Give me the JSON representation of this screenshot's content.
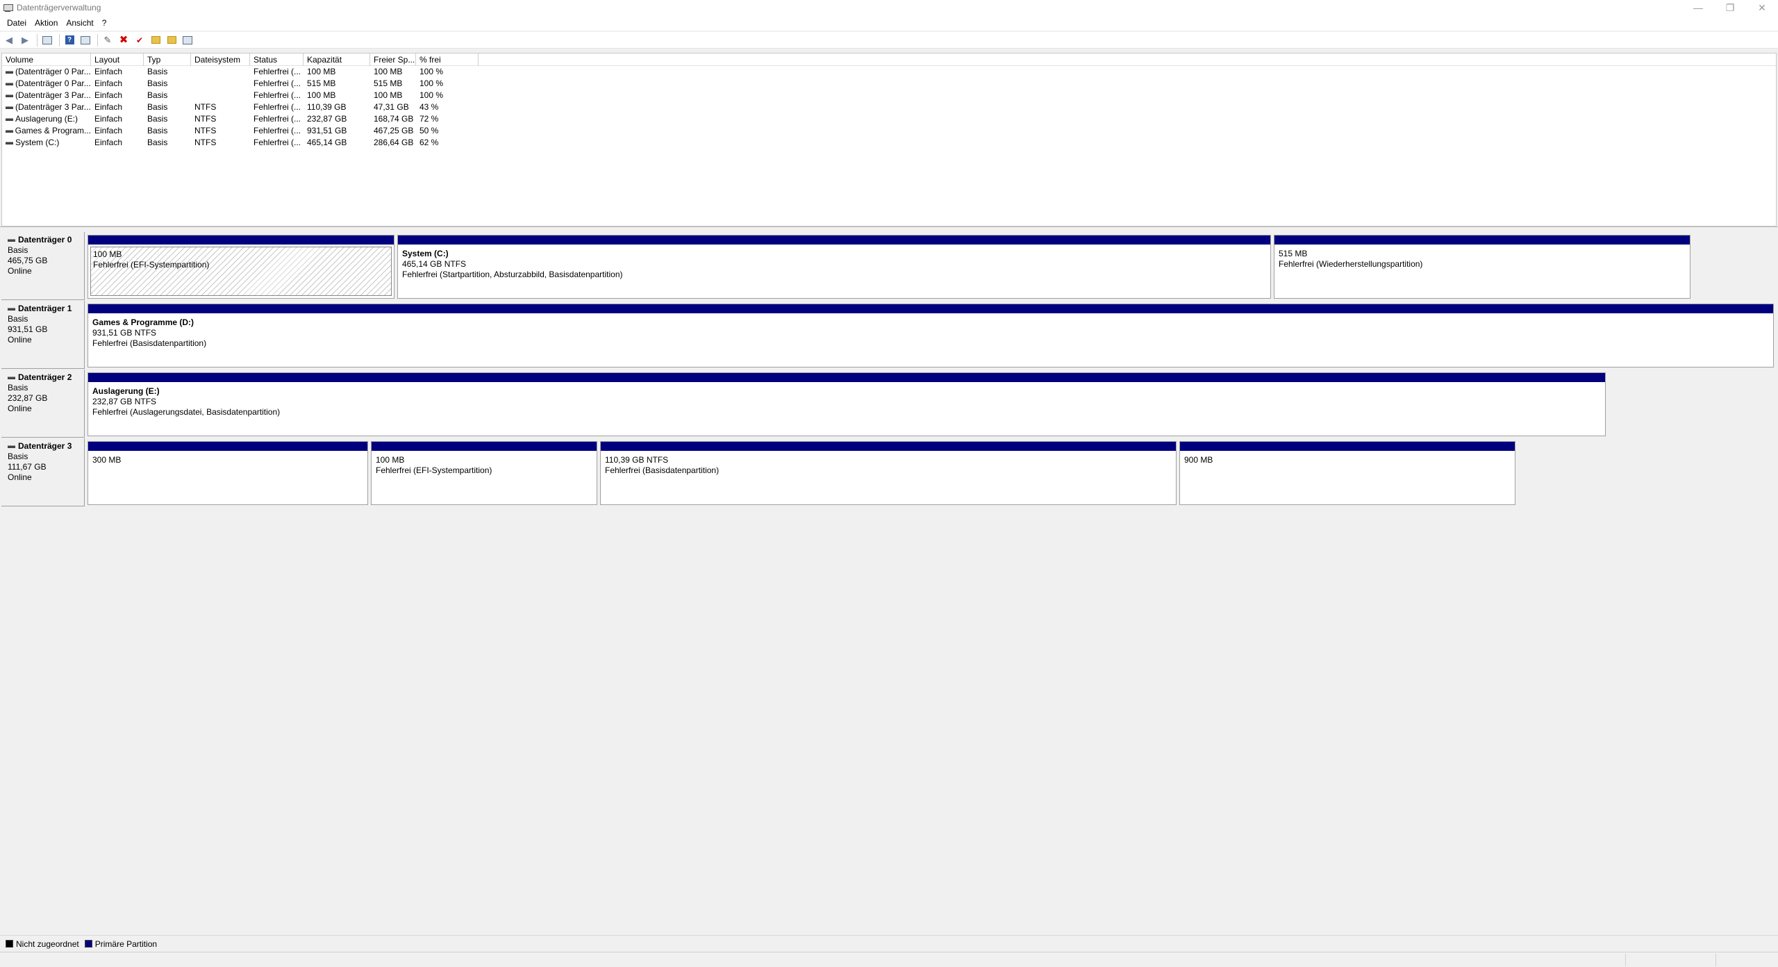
{
  "window": {
    "title": "Datenträgerverwaltung",
    "controls": {
      "minimize": "—",
      "restore": "❐",
      "close": "✕"
    }
  },
  "menu": [
    "Datei",
    "Aktion",
    "Ansicht",
    "?"
  ],
  "toolbar": {
    "icons": [
      "back-arrow-icon",
      "forward-arrow-icon",
      "console-tree-icon",
      "help-icon",
      "properties-icon",
      "connect-icon",
      "delete-icon",
      "checkmark-icon",
      "folder-up-icon",
      "folder-new-icon",
      "view-icon"
    ]
  },
  "volume_list": {
    "columns": [
      "Volume",
      "Layout",
      "Typ",
      "Dateisystem",
      "Status",
      "Kapazität",
      "Freier Sp...",
      "% frei"
    ],
    "rows": [
      [
        "(Datenträger 0 Par...",
        "Einfach",
        "Basis",
        "",
        "Fehlerfrei (...",
        "100 MB",
        "100 MB",
        "100 %"
      ],
      [
        "(Datenträger 0 Par...",
        "Einfach",
        "Basis",
        "",
        "Fehlerfrei (...",
        "515 MB",
        "515 MB",
        "100 %"
      ],
      [
        "(Datenträger 3 Par...",
        "Einfach",
        "Basis",
        "",
        "Fehlerfrei (...",
        "100 MB",
        "100 MB",
        "100 %"
      ],
      [
        "(Datenträger 3 Par...",
        "Einfach",
        "Basis",
        "NTFS",
        "Fehlerfrei (...",
        "110,39 GB",
        "47,31 GB",
        "43 %"
      ],
      [
        "Auslagerung (E:)",
        "Einfach",
        "Basis",
        "NTFS",
        "Fehlerfrei (...",
        "232,87 GB",
        "168,74 GB",
        "72 %"
      ],
      [
        "Games & Program...",
        "Einfach",
        "Basis",
        "NTFS",
        "Fehlerfrei (...",
        "931,51 GB",
        "467,25 GB",
        "50 %"
      ],
      [
        "System (C:)",
        "Einfach",
        "Basis",
        "NTFS",
        "Fehlerfrei (...",
        "465,14 GB",
        "286,64 GB",
        "62 %"
      ]
    ]
  },
  "disks": [
    {
      "name": "Datenträger 0",
      "type": "Basis",
      "size": "465,75 GB",
      "state": "Online",
      "partitions": [
        {
          "title": "",
          "size": "100 MB",
          "status": "Fehlerfrei (EFI-Systempartition)"
        },
        {
          "title": "System  (C:)",
          "size": "465,14 GB NTFS",
          "status": "Fehlerfrei (Startpartition, Absturzabbild, Basisdatenpartition)"
        },
        {
          "title": "",
          "size": "515 MB",
          "status": "Fehlerfrei (Wiederherstellungspartition)"
        }
      ]
    },
    {
      "name": "Datenträger 1",
      "type": "Basis",
      "size": "931,51 GB",
      "state": "Online",
      "partitions": [
        {
          "title": "Games & Programme  (D:)",
          "size": "931,51 GB NTFS",
          "status": "Fehlerfrei (Basisdatenpartition)"
        }
      ]
    },
    {
      "name": "Datenträger 2",
      "type": "Basis",
      "size": "232,87 GB",
      "state": "Online",
      "partitions": [
        {
          "title": "Auslagerung  (E:)",
          "size": "232,87 GB NTFS",
          "status": "Fehlerfrei (Auslagerungsdatei, Basisdatenpartition)"
        }
      ]
    },
    {
      "name": "Datenträger 3",
      "type": "Basis",
      "size": "111,67 GB",
      "state": "Online",
      "partitions": [
        {
          "title": "",
          "size": "300 MB",
          "status": ""
        },
        {
          "title": "",
          "size": "100 MB",
          "status": "Fehlerfrei (EFI-Systempartition)"
        },
        {
          "title": "",
          "size": "110,39 GB NTFS",
          "status": "Fehlerfrei (Basisdatenpartition)"
        },
        {
          "title": "",
          "size": "900 MB",
          "status": ""
        }
      ]
    }
  ],
  "legend": {
    "unallocated": "Nicht zugeordnet",
    "primary": "Primäre Partition",
    "colors": {
      "unallocated": "#000000",
      "primary": "#00007f"
    }
  }
}
